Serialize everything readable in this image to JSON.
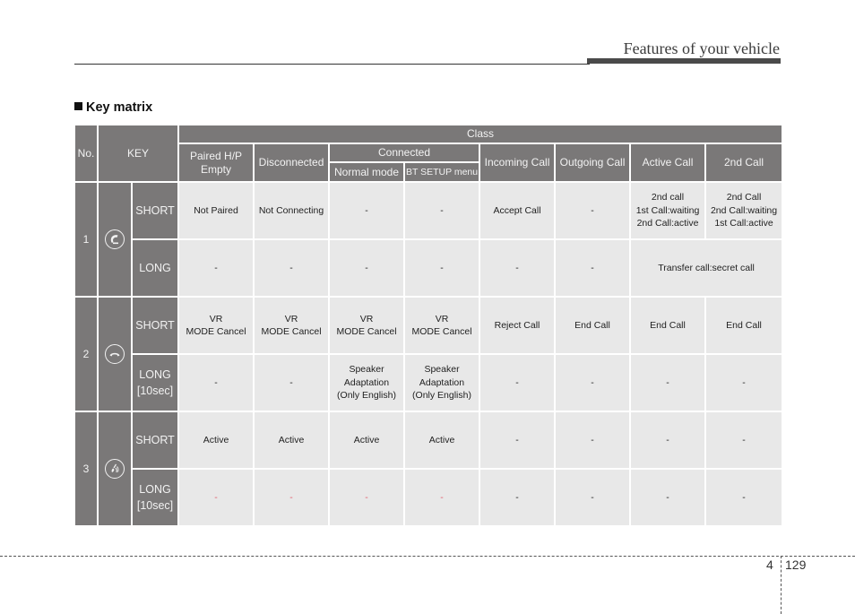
{
  "header": {
    "title": "Features of your vehicle"
  },
  "section": {
    "title": "Key matrix"
  },
  "table": {
    "col_no": "No.",
    "col_key": "KEY",
    "class_label": "Class",
    "classes": {
      "paired": "Paired H/P Empty",
      "disconnected": "Disconnected",
      "connected": "Connected",
      "normal_mode": "Normal mode",
      "bt_setup": "BT SETUP menu",
      "incoming": "Incoming Call",
      "outgoing": "Outgoing Call",
      "active": "Active Call",
      "second": "2nd Call"
    },
    "rows": [
      {
        "no": "1",
        "icon": "phone-answer-icon",
        "short": {
          "label": "SHORT",
          "cells": [
            "Not Paired",
            "Not Connecting",
            "-",
            "-",
            "Accept Call",
            "-",
            "2nd call\n1st Call:waiting\n2nd Call:active",
            "2nd Call\n2nd Call:waiting\n1st Call:active"
          ]
        },
        "long": {
          "label": "LONG",
          "cells": [
            "-",
            "-",
            "-",
            "-",
            "-",
            "-"
          ],
          "merged": "Transfer call:secret call"
        }
      },
      {
        "no": "2",
        "icon": "phone-hangup-icon",
        "short": {
          "label": "SHORT",
          "cells": [
            "VR\nMODE Cancel",
            "VR\nMODE Cancel",
            "VR\nMODE Cancel",
            "VR\nMODE Cancel",
            "Reject Call",
            "End Call",
            "End Call",
            "End Call"
          ]
        },
        "long": {
          "label": "LONG\n[10sec]",
          "cells": [
            "-",
            "-",
            "Speaker\nAdaptation\n(Only English)",
            "Speaker\nAdaptation\n(Only English)",
            "-",
            "-",
            "-",
            "-"
          ]
        }
      },
      {
        "no": "3",
        "icon": "voice-recognition-icon",
        "short": {
          "label": "SHORT",
          "cells": [
            "Active",
            "Active",
            "Active",
            "Active",
            "-",
            "-",
            "-",
            "-"
          ]
        },
        "long": {
          "label": "LONG\n[10sec]",
          "cells": [
            "-",
            "-",
            "-",
            "-",
            "-",
            "-",
            "-",
            "-"
          ]
        }
      }
    ],
    "highlight_color": "#e05a6a"
  },
  "footer": {
    "section": "4",
    "page": "129"
  }
}
